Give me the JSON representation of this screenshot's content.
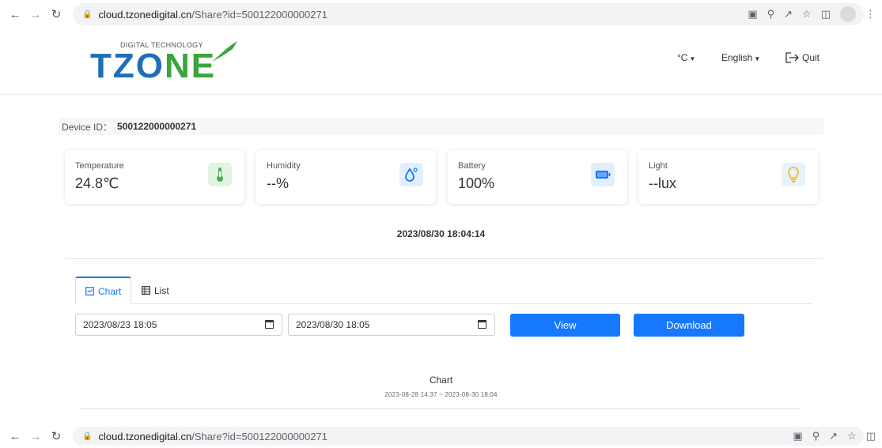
{
  "browser": {
    "url_host": "cloud.tzonedigital.cn",
    "url_path": "/Share?id=500122000000271"
  },
  "logo": {
    "tagline": "DIGITAL TECHNOLOGY",
    "brand_a": "TZO",
    "brand_b": "NE"
  },
  "header": {
    "unit": "°C",
    "language": "English",
    "quit": "Quit"
  },
  "device": {
    "label": "Device ID：",
    "id": "500122000000271"
  },
  "sensors": [
    {
      "label": "Temperature",
      "value": "24.8℃",
      "icon": "thermometer-icon",
      "color": "#4caf50",
      "bg": "#e3f3e4"
    },
    {
      "label": "Humidity",
      "value": "--%",
      "icon": "water-drop-icon",
      "color": "#1677ff",
      "bg": "#e3eefc"
    },
    {
      "label": "Battery",
      "value": "100%",
      "icon": "battery-icon",
      "color": "#1677ff",
      "bg": "#e3eefc"
    },
    {
      "label": "Light",
      "value": "--lux",
      "icon": "lightbulb-icon",
      "color": "#f5b800",
      "bg": "#e8f1fc"
    }
  ],
  "timestamp": "2023/08/30 18:04:14",
  "tabs": {
    "chart": "Chart",
    "list": "List"
  },
  "range": {
    "start": "2023/08/23 18:05",
    "end": "2023/08/30 18:05"
  },
  "actions": {
    "view": "View",
    "download": "Download"
  },
  "chart": {
    "title": "Chart",
    "subtitle": "2023-08-28 14:37 ~ 2023-08-30 18:04"
  }
}
